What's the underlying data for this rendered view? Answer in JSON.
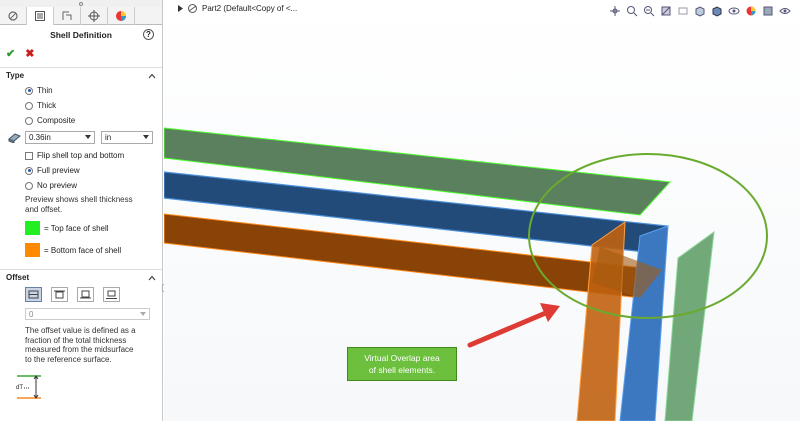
{
  "panel": {
    "title": "Shell Definition",
    "help_glyph": "?",
    "ok_glyph": "✔",
    "cancel_glyph": "✖",
    "type_section": {
      "label": "Type",
      "options": [
        "Thin",
        "Thick",
        "Composite"
      ],
      "selected": "Thin"
    },
    "thickness": {
      "value": "0.36in",
      "unit": "in"
    },
    "flip_label": "Flip shell top and bottom",
    "preview_options": [
      "Full preview",
      "No preview"
    ],
    "preview_selected": "Full preview",
    "preview_note": "Preview shows shell thickness and offset.",
    "legend": [
      {
        "label": "= Top face of shell",
        "color": "#22ee22"
      },
      {
        "label": "= Bottom face of shell",
        "color": "#ff8a00"
      }
    ],
    "offset_section": {
      "label": "Offset",
      "value": "0",
      "note": "The offset value is defined as a fraction of the total thickness measured from the midsurface to the reference surface."
    }
  },
  "tree": {
    "label": "Part2  (Default<Copy of <..."
  },
  "callout": {
    "line1": "Virtual Overlap area",
    "line2": "of shell elements."
  },
  "colors": {
    "top_face": "#3e9a30",
    "blue_shell": "#234b7a",
    "orange_shell": "#8a4307",
    "annotation_green": "#6aaa2f",
    "arrow_red": "#dd3b33"
  }
}
